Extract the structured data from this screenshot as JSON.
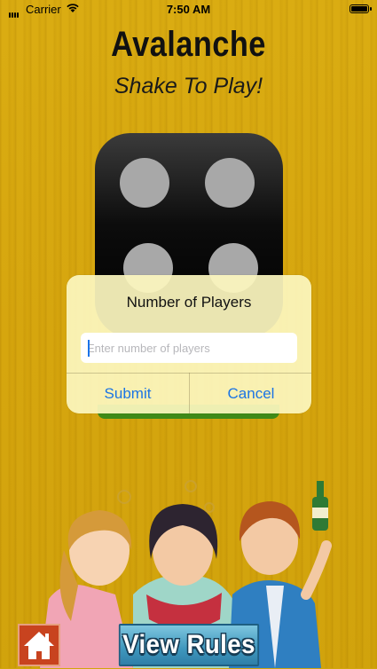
{
  "status_bar": {
    "carrier": "Carrier",
    "time": "7:50 AM",
    "battery_level": 1.0
  },
  "header": {
    "title": "Avalanche",
    "subtitle": "Shake To Play!"
  },
  "dice": {
    "face_value": 4,
    "color": "#000000",
    "pip_color": "#a8a8a8"
  },
  "alert": {
    "title": "Number of Players",
    "input": {
      "placeholder": "Enter number of players",
      "value": ""
    },
    "buttons": {
      "submit_label": "Submit",
      "cancel_label": "Cancel"
    },
    "accent_color": "#1b74e4"
  },
  "footer": {
    "home_icon": "home-icon",
    "view_rules_label": "View Rules"
  },
  "colors": {
    "background": "#d2a50c",
    "home_button": "#c8431f",
    "view_rules_button": "#3f97bd",
    "start_bar": "#3f8a18"
  }
}
